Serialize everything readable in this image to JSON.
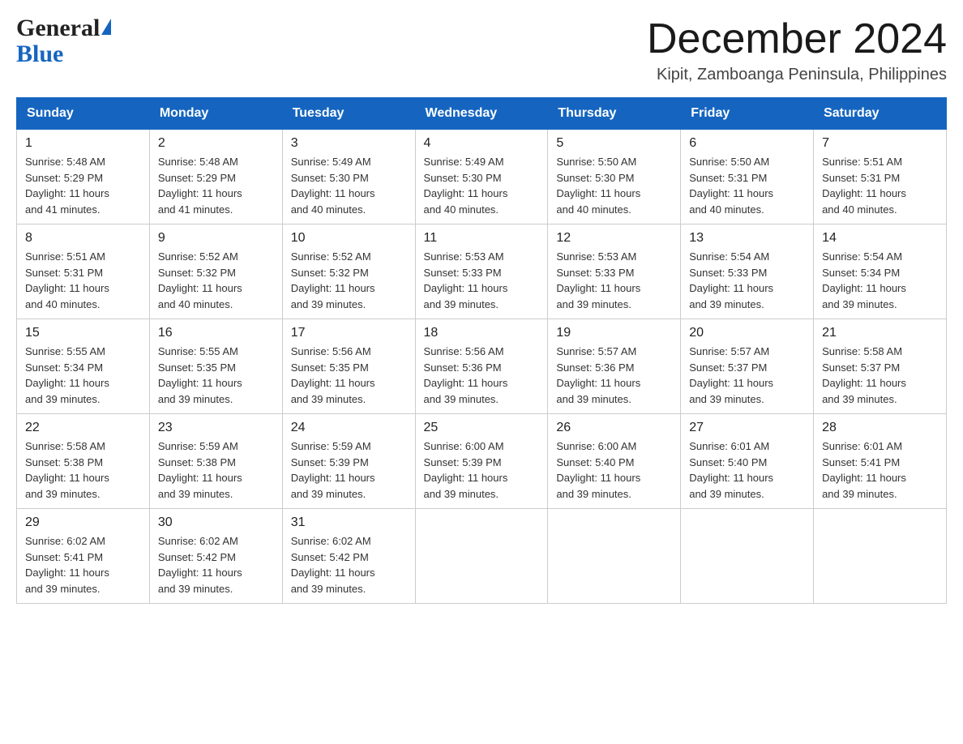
{
  "logo": {
    "general": "General",
    "blue": "Blue",
    "triangle": "▶"
  },
  "title": {
    "month_year": "December 2024",
    "location": "Kipit, Zamboanga Peninsula, Philippines"
  },
  "headers": [
    "Sunday",
    "Monday",
    "Tuesday",
    "Wednesday",
    "Thursday",
    "Friday",
    "Saturday"
  ],
  "weeks": [
    [
      {
        "day": "1",
        "sunrise": "5:48 AM",
        "sunset": "5:29 PM",
        "daylight": "11 hours and 41 minutes."
      },
      {
        "day": "2",
        "sunrise": "5:48 AM",
        "sunset": "5:29 PM",
        "daylight": "11 hours and 41 minutes."
      },
      {
        "day": "3",
        "sunrise": "5:49 AM",
        "sunset": "5:30 PM",
        "daylight": "11 hours and 40 minutes."
      },
      {
        "day": "4",
        "sunrise": "5:49 AM",
        "sunset": "5:30 PM",
        "daylight": "11 hours and 40 minutes."
      },
      {
        "day": "5",
        "sunrise": "5:50 AM",
        "sunset": "5:30 PM",
        "daylight": "11 hours and 40 minutes."
      },
      {
        "day": "6",
        "sunrise": "5:50 AM",
        "sunset": "5:31 PM",
        "daylight": "11 hours and 40 minutes."
      },
      {
        "day": "7",
        "sunrise": "5:51 AM",
        "sunset": "5:31 PM",
        "daylight": "11 hours and 40 minutes."
      }
    ],
    [
      {
        "day": "8",
        "sunrise": "5:51 AM",
        "sunset": "5:31 PM",
        "daylight": "11 hours and 40 minutes."
      },
      {
        "day": "9",
        "sunrise": "5:52 AM",
        "sunset": "5:32 PM",
        "daylight": "11 hours and 40 minutes."
      },
      {
        "day": "10",
        "sunrise": "5:52 AM",
        "sunset": "5:32 PM",
        "daylight": "11 hours and 39 minutes."
      },
      {
        "day": "11",
        "sunrise": "5:53 AM",
        "sunset": "5:33 PM",
        "daylight": "11 hours and 39 minutes."
      },
      {
        "day": "12",
        "sunrise": "5:53 AM",
        "sunset": "5:33 PM",
        "daylight": "11 hours and 39 minutes."
      },
      {
        "day": "13",
        "sunrise": "5:54 AM",
        "sunset": "5:33 PM",
        "daylight": "11 hours and 39 minutes."
      },
      {
        "day": "14",
        "sunrise": "5:54 AM",
        "sunset": "5:34 PM",
        "daylight": "11 hours and 39 minutes."
      }
    ],
    [
      {
        "day": "15",
        "sunrise": "5:55 AM",
        "sunset": "5:34 PM",
        "daylight": "11 hours and 39 minutes."
      },
      {
        "day": "16",
        "sunrise": "5:55 AM",
        "sunset": "5:35 PM",
        "daylight": "11 hours and 39 minutes."
      },
      {
        "day": "17",
        "sunrise": "5:56 AM",
        "sunset": "5:35 PM",
        "daylight": "11 hours and 39 minutes."
      },
      {
        "day": "18",
        "sunrise": "5:56 AM",
        "sunset": "5:36 PM",
        "daylight": "11 hours and 39 minutes."
      },
      {
        "day": "19",
        "sunrise": "5:57 AM",
        "sunset": "5:36 PM",
        "daylight": "11 hours and 39 minutes."
      },
      {
        "day": "20",
        "sunrise": "5:57 AM",
        "sunset": "5:37 PM",
        "daylight": "11 hours and 39 minutes."
      },
      {
        "day": "21",
        "sunrise": "5:58 AM",
        "sunset": "5:37 PM",
        "daylight": "11 hours and 39 minutes."
      }
    ],
    [
      {
        "day": "22",
        "sunrise": "5:58 AM",
        "sunset": "5:38 PM",
        "daylight": "11 hours and 39 minutes."
      },
      {
        "day": "23",
        "sunrise": "5:59 AM",
        "sunset": "5:38 PM",
        "daylight": "11 hours and 39 minutes."
      },
      {
        "day": "24",
        "sunrise": "5:59 AM",
        "sunset": "5:39 PM",
        "daylight": "11 hours and 39 minutes."
      },
      {
        "day": "25",
        "sunrise": "6:00 AM",
        "sunset": "5:39 PM",
        "daylight": "11 hours and 39 minutes."
      },
      {
        "day": "26",
        "sunrise": "6:00 AM",
        "sunset": "5:40 PM",
        "daylight": "11 hours and 39 minutes."
      },
      {
        "day": "27",
        "sunrise": "6:01 AM",
        "sunset": "5:40 PM",
        "daylight": "11 hours and 39 minutes."
      },
      {
        "day": "28",
        "sunrise": "6:01 AM",
        "sunset": "5:41 PM",
        "daylight": "11 hours and 39 minutes."
      }
    ],
    [
      {
        "day": "29",
        "sunrise": "6:02 AM",
        "sunset": "5:41 PM",
        "daylight": "11 hours and 39 minutes."
      },
      {
        "day": "30",
        "sunrise": "6:02 AM",
        "sunset": "5:42 PM",
        "daylight": "11 hours and 39 minutes."
      },
      {
        "day": "31",
        "sunrise": "6:02 AM",
        "sunset": "5:42 PM",
        "daylight": "11 hours and 39 minutes."
      },
      null,
      null,
      null,
      null
    ]
  ],
  "labels": {
    "sunrise": "Sunrise:",
    "sunset": "Sunset:",
    "daylight": "Daylight:"
  }
}
